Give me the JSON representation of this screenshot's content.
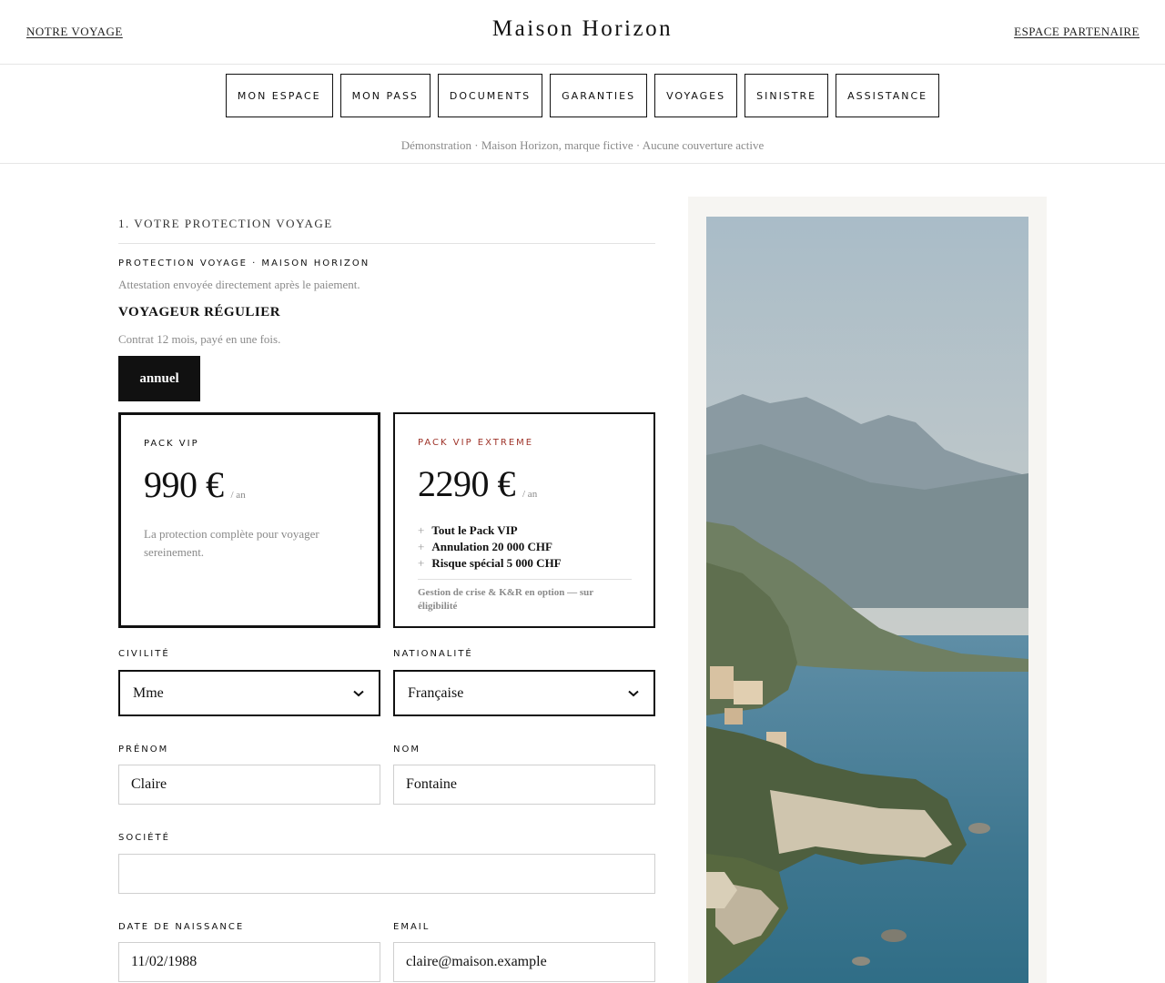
{
  "header": {
    "left_link": "NOTRE VOYAGE",
    "brand": "Maison Horizon",
    "right_link": "ESPACE PARTENAIRE"
  },
  "nav": {
    "tabs": [
      "MON ESPACE",
      "MON PASS",
      "DOCUMENTS",
      "GARANTIES",
      "VOYAGES",
      "SINISTRE",
      "ASSISTANCE"
    ]
  },
  "notice": "Démonstration · Maison Horizon, marque fictive · Aucune couverture active",
  "form": {
    "section_title": "1. VOTRE PROTECTION VOYAGE",
    "eyebrow": "PROTECTION VOYAGE · MAISON HORIZON",
    "attestation": "Attestation envoyée directement après le paiement.",
    "plan_name": "VOYAGEUR RÉGULIER",
    "plan_desc": "Contrat 12 mois, payé en une fois.",
    "billing_label": "annuel",
    "cards": {
      "vip": {
        "label": "PACK VIP",
        "price": "990 €",
        "per": "/ an",
        "desc": "La protection complète pour voyager sereinement."
      },
      "extreme": {
        "label": "PACK VIP EXTREME",
        "price": "2290 €",
        "per": "/ an",
        "features": [
          "Tout le Pack VIP",
          "Annulation 20 000 CHF",
          "Risque spécial 5 000 CHF"
        ],
        "note": "Gestion de crise & K&R en option — sur éligibilité"
      }
    },
    "fields": {
      "civilite": {
        "label": "CIVILITÉ",
        "value": "Mme"
      },
      "nationalite": {
        "label": "NATIONALITÉ",
        "value": "Française"
      },
      "prenom": {
        "label": "PRÉNOM",
        "value": "Claire"
      },
      "nom": {
        "label": "NOM",
        "value": "Fontaine"
      },
      "societe": {
        "label": "SOCIÉTÉ",
        "value": ""
      },
      "naissance": {
        "label": "DATE DE NAISSANCE",
        "value": "11/02/1988"
      },
      "email": {
        "label": "EMAIL",
        "value": "claire@maison.example"
      }
    }
  },
  "colors": {
    "ink": "#111111",
    "muted": "#8a8a8a",
    "accent_red": "#9e3228",
    "panel": "#f6f5f2"
  },
  "icons": {
    "feature_bullet": "plus-icon",
    "select_arrow": "chevron-down-icon"
  }
}
